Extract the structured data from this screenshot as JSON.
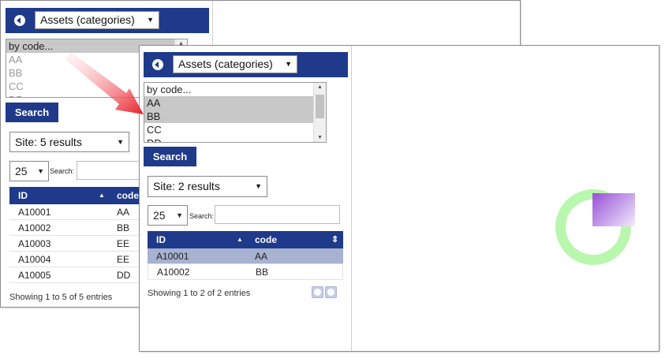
{
  "back_panel": {
    "category_select": "Assets (categories)",
    "list_options": [
      "by code...",
      "AA",
      "BB",
      "CC",
      "DD"
    ],
    "search_button": "Search",
    "site_select": "Site: 5 results",
    "page_size": "25",
    "search_label": "Search:",
    "columns": [
      "ID",
      "code"
    ],
    "rows": [
      {
        "id": "A10001",
        "code": "AA"
      },
      {
        "id": "A10002",
        "code": "BB"
      },
      {
        "id": "A10003",
        "code": "EE"
      },
      {
        "id": "A10004",
        "code": "EE"
      },
      {
        "id": "A10005",
        "code": "DD"
      }
    ],
    "footer": "Showing 1 to 5 of 5 entries"
  },
  "front_panel": {
    "category_select": "Assets (categories)",
    "list_options": [
      "by code...",
      "AA",
      "BB",
      "CC",
      "DD"
    ],
    "search_button": "Search",
    "site_select": "Site: 2 results",
    "page_size": "25",
    "search_label": "Search:",
    "columns": [
      "ID",
      "code"
    ],
    "rows": [
      {
        "id": "A10001",
        "code": "AA"
      },
      {
        "id": "A10002",
        "code": "BB"
      }
    ],
    "footer": "Showing 1 to 2 of 2 entries"
  },
  "icons": {
    "back": "back-circle-icon",
    "caret": "▼",
    "sort_asc": "▲",
    "sort_both": "⇕",
    "prev": "prev-page-icon",
    "next": "next-page-icon"
  },
  "colors": {
    "header_blue": "#1f3a8a",
    "selected_row": "#a6b2d0",
    "arrow_red": "#e8202a",
    "ring_green": "#b8f7ad",
    "square_purple": "#9a4fd6"
  }
}
